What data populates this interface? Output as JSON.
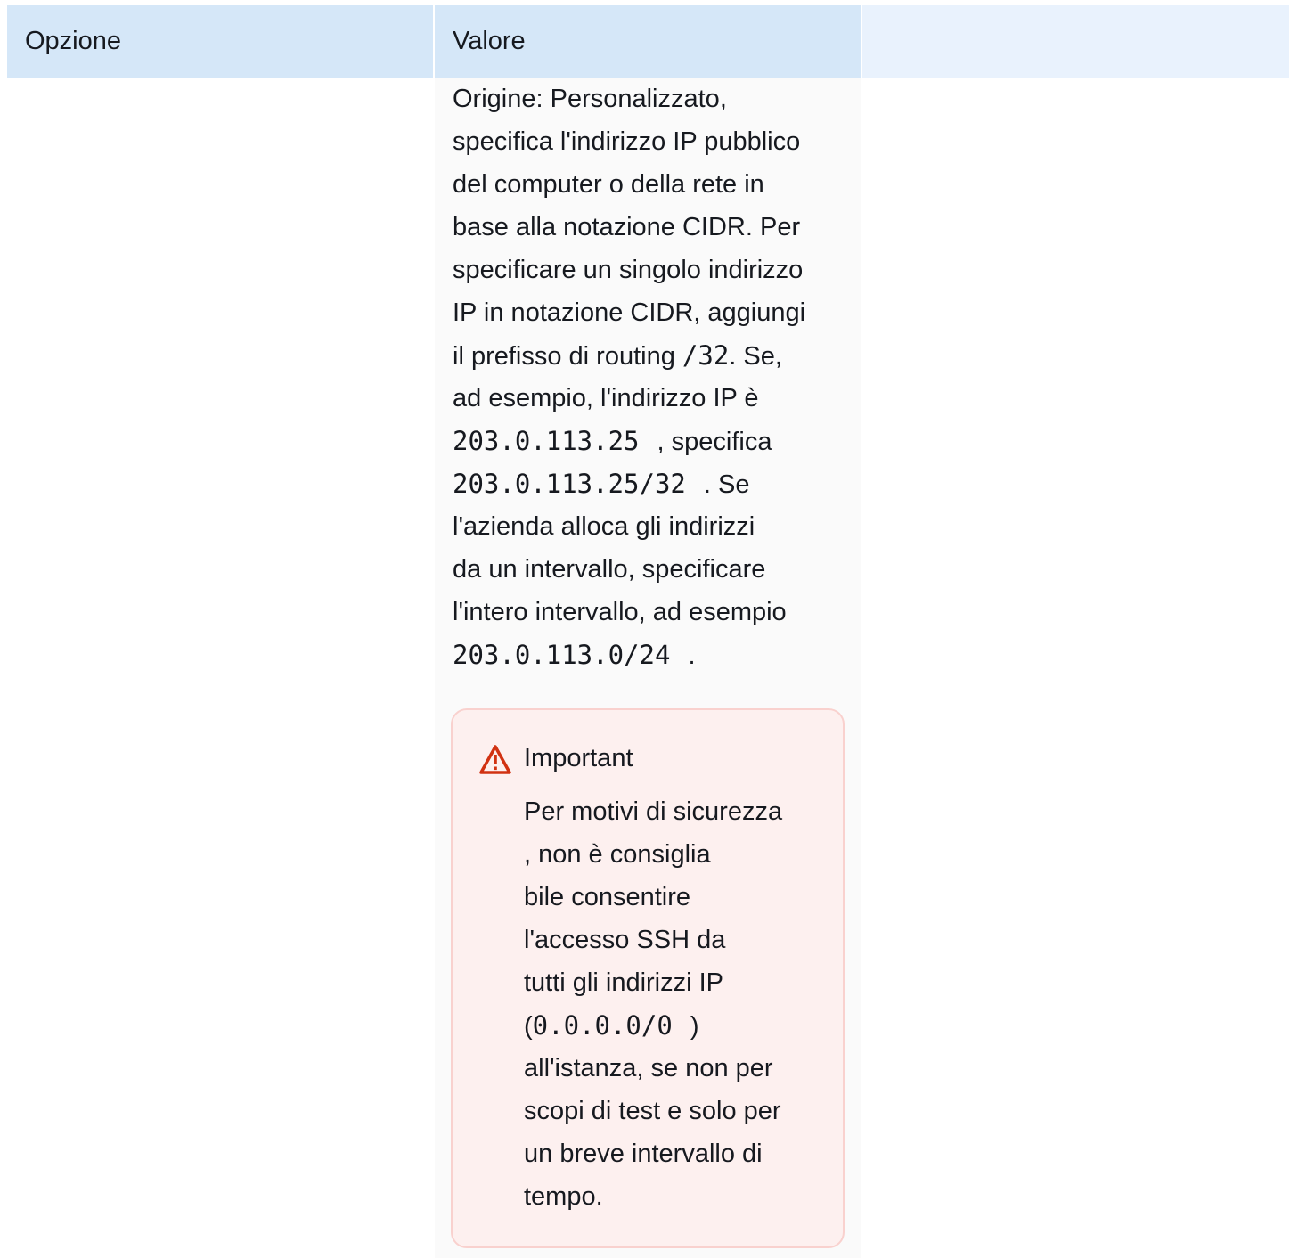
{
  "table": {
    "headers": {
      "option": "Opzione",
      "value": "Valore"
    },
    "value_lines": [
      "Origine: Personalizzato,",
      "specifica l'indirizzo IP pubblico",
      "del computer o della rete in",
      "base alla notazione CIDR. Per",
      "specificare un singolo indirizzo",
      "IP in notazione CIDR, aggiungi"
    ],
    "routing_line": {
      "before": "il prefisso di routing ",
      "code": "/32",
      "after": ". Se,"
    },
    "example_line": "ad esempio, l'indirizzo IP è",
    "ip_line": {
      "code": "203.0.113.25",
      "after": ", specifica"
    },
    "ip_cidr_line": {
      "code": "203.0.113.25/32",
      "after": ". Se"
    },
    "range_lines": [
      "l'azienda alloca gli indirizzi",
      "da un intervallo, specificare",
      "l'intero intervallo, ad esempio"
    ],
    "range_line": {
      "code": "203.0.113.0/24",
      "after": "."
    }
  },
  "alert": {
    "icon": "warning-triangle-icon",
    "color": "#d13212",
    "title": "Important",
    "lines_before": [
      "Per motivi di sicurezza",
      ", non è consiglia",
      "bile consentire",
      "l'accesso SSH da",
      "tutti gli indirizzi IP"
    ],
    "code_line": {
      "before": "(",
      "code": "0.0.0.0/0",
      "after": ")"
    },
    "lines_after": [
      "all'istanza, se non per",
      "scopi di test e solo per",
      "un breve intervallo di",
      "tempo."
    ]
  }
}
